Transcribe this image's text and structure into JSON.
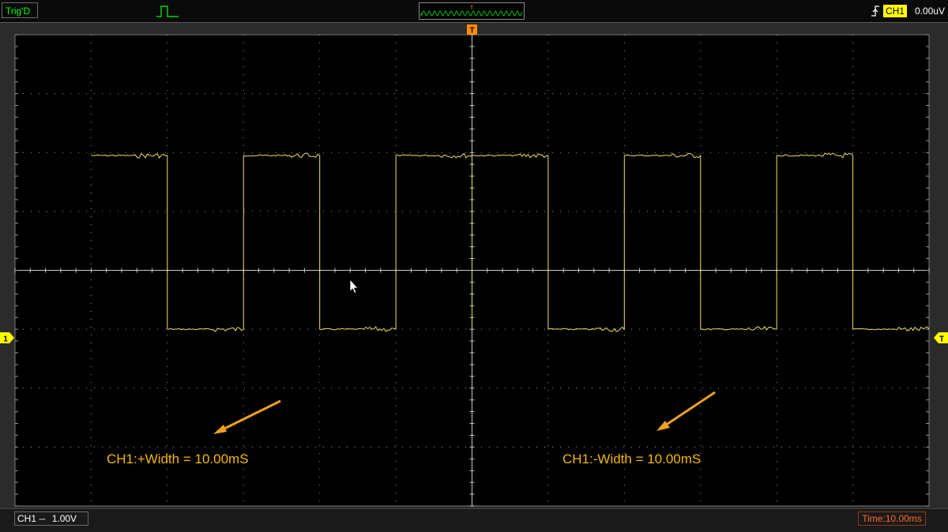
{
  "header": {
    "trigger_status": "Trig'D",
    "overview_trigger_marker": "T",
    "trigger_channel": "CH1",
    "trigger_level": "0.00uV",
    "trigger_edge_icon": "rising-edge-icon"
  },
  "screen": {
    "trigger_marker": "T",
    "ch1_ground_marker_left": "1",
    "trigger_level_marker_right": "T",
    "annotations": [
      {
        "label": "CH1:+Width = 10.00mS"
      },
      {
        "label": "CH1:-Width = 10.00mS"
      }
    ],
    "colors": {
      "trace": "#e8e060",
      "grid": "#9a9a9a",
      "annotation": "#f5b800",
      "arrow": "#f0a020",
      "background": "#000000"
    }
  },
  "footer": {
    "channel": "CH1",
    "coupling_symbol": "⎓",
    "volts_per_div": "1.00V",
    "time_base": "Time:10.00ms"
  },
  "chart_data": {
    "type": "line",
    "series": [
      {
        "points": [
          [
            -50,
            1.95
          ],
          [
            -40,
            1.95
          ],
          [
            -40,
            -1.0
          ],
          [
            -30,
            -1.0
          ],
          [
            -30,
            1.95
          ],
          [
            -20,
            1.95
          ],
          [
            -20,
            -1.0
          ],
          [
            -10,
            -1.0
          ],
          [
            -10,
            1.95
          ],
          [
            0,
            1.95
          ],
          [
            0,
            -1.0
          ],
          [
            0,
            1.95
          ],
          [
            10,
            1.95
          ],
          [
            10,
            -1.0
          ],
          [
            20,
            -1.0
          ],
          [
            20,
            1.95
          ],
          [
            30,
            1.95
          ],
          [
            30,
            -1.0
          ],
          [
            40,
            -1.0
          ],
          [
            40,
            1.95
          ],
          [
            50,
            1.95
          ],
          [
            50,
            -1.0
          ],
          [
            60,
            -1.0
          ]
        ]
      }
    ],
    "xlim": [
      -60,
      60
    ],
    "ylim": [
      -4,
      4
    ],
    "grid": true
  }
}
